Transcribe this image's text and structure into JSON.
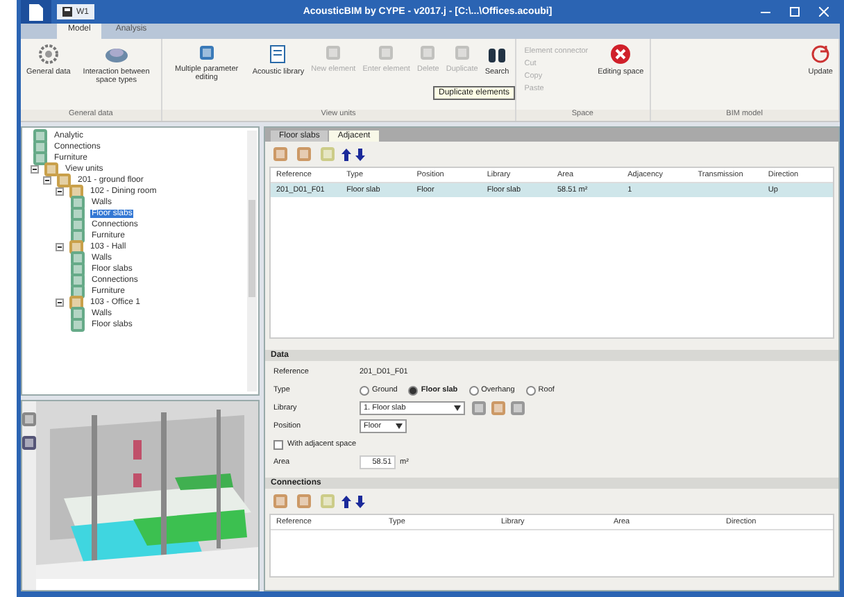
{
  "window": {
    "title": "AcousticBIM by CYPE - v2017.j - [C:\\...\\Offices.acoubi]"
  },
  "quick_access": {
    "label": "W1"
  },
  "menu_tabs": [
    {
      "label": "Model",
      "selected": true
    },
    {
      "label": "Analysis",
      "selected": false
    }
  ],
  "ribbon_groups": [
    {
      "label": "General data",
      "buttons": [
        {
          "label": "General data",
          "disabled": false
        },
        {
          "label": "Interaction between space types",
          "disabled": false
        }
      ]
    },
    {
      "label": "View units",
      "buttons": [
        {
          "label": "Multiple parameter editing",
          "disabled": false
        },
        {
          "label": "Acoustic library",
          "disabled": false
        },
        {
          "label": "New element",
          "disabled": true
        },
        {
          "label": "Enter element",
          "disabled": true
        },
        {
          "label": "Delete",
          "disabled": true
        },
        {
          "label": "Duplicate",
          "disabled": true
        },
        {
          "label": "Search",
          "disabled": false
        }
      ]
    },
    {
      "label": "Space",
      "small": [
        {
          "label": "Element connector",
          "disabled": true
        },
        {
          "label": "Cut",
          "disabled": true
        },
        {
          "label": "Copy",
          "disabled": true
        },
        {
          "label": "Paste",
          "disabled": true
        }
      ],
      "buttons": [
        {
          "label": "Editing space",
          "disabled": false
        }
      ]
    },
    {
      "label": "BIM model",
      "buttons": [
        {
          "label": "Update",
          "disabled": false
        }
      ]
    }
  ],
  "tooltip": "Duplicate elements",
  "tree": [
    {
      "label": "Analytic"
    },
    {
      "label": "Connections"
    },
    {
      "label": "Furniture"
    },
    {
      "label": "View units",
      "expanded": true,
      "children": [
        {
          "label": "201 - ground floor",
          "expanded": true,
          "children": [
            {
              "label": "102 - Dining room",
              "expanded": true,
              "children": [
                {
                  "label": "Walls",
                  "selected": false
                },
                {
                  "label": "Floor slabs",
                  "selected": true
                },
                {
                  "label": "Connections",
                  "selected": false
                },
                {
                  "label": "Furniture",
                  "selected": false
                }
              ]
            },
            {
              "label": "103 - Hall",
              "expanded": true,
              "children": [
                {
                  "label": "Walls",
                  "selected": false
                },
                {
                  "label": "Floor slabs",
                  "selected": false
                },
                {
                  "label": "Connections",
                  "selected": false
                },
                {
                  "label": "Furniture",
                  "selected": false
                }
              ]
            },
            {
              "label": "103 - Office 1",
              "expanded": true,
              "children": [
                {
                  "label": "Walls",
                  "selected": false
                },
                {
                  "label": "Floor slabs",
                  "selected": false
                }
              ]
            }
          ]
        }
      ]
    }
  ],
  "element_tabs": [
    {
      "label": "Floor slabs",
      "selected": false
    },
    {
      "label": "Adjacent",
      "selected": true
    }
  ],
  "elements_table": {
    "columns": [
      "Reference",
      "Type",
      "Position",
      "Library",
      "Area",
      "Adjacency",
      "Transmission",
      "Direction"
    ],
    "rows": [
      {
        "cells": [
          "201_D01_F01",
          "Floor slab",
          "Floor",
          "Floor slab",
          "58.51 m²",
          "1",
          "",
          "Up"
        ],
        "selected": true
      }
    ]
  },
  "data_panel": {
    "title": "Data",
    "reference_label": "Reference",
    "reference": "201_D01_F01",
    "type_label": "Type",
    "types": [
      {
        "label": "Ground",
        "selected": false
      },
      {
        "label": "Floor slab",
        "selected": true
      },
      {
        "label": "Overhang",
        "selected": false
      },
      {
        "label": "Roof",
        "selected": false
      }
    ],
    "library_label": "Library",
    "library": "1. Floor slab",
    "position_label": "Position",
    "position": "Floor",
    "adjacent": {
      "label": "With adjacent space",
      "checked": false
    },
    "area_label": "Area",
    "area": "58.51",
    "area_unit": "m²"
  },
  "connections_panel": {
    "title": "Connections",
    "columns": [
      "Reference",
      "Type",
      "Library",
      "Area",
      "Direction"
    ]
  }
}
